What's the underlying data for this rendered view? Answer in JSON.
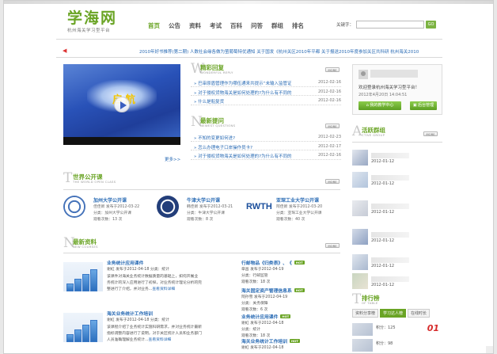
{
  "header": {
    "logo_title": "学海网",
    "logo_subtitle": "杭州海关学习型平台",
    "nav": [
      "首页",
      "公告",
      "资料",
      "考试",
      "百科",
      "问答",
      "群组",
      "排名"
    ],
    "keyword_label": "关键字：",
    "go_label": "GO"
  },
  "ticker": "2010年好书推荐(第二期)  人数社会缘各做为萤葡萄特优通知  关于国发《杭州关区2010年平都  关于报送2010年度参加关区共科研  杭州海关2010",
  "video": {
    "caption": "启航",
    "more": "更多>>"
  },
  "qa": {
    "title": "精彩回复",
    "en": "WONDERFUL REPLY",
    "rows": [
      {
        "q": "巴审原盾管理作为哪伍通来共提示“未输入监管证",
        "d": "2012-02-16"
      },
      {
        "q": "对于侵权货物海关是如何处理的?为什么有不同的",
        "d": "2012-02-16"
      },
      {
        "q": "什么是船复货",
        "d": "2012-02-16"
      }
    ],
    "new_title": "最新提问",
    "new_en": "NEWEST QUESTIONS",
    "new_rows": [
      {
        "q": "不知的变更如何进?",
        "d": "2012-02-23"
      },
      {
        "q": "怎么办理电子口岸操作员卡?",
        "d": "2012-02-17"
      },
      {
        "q": "对于侵权货物海关是如何处理的?为什么有不同的",
        "d": "2012-02-16"
      }
    ],
    "more": "MORE"
  },
  "open_class": {
    "title": "世界公开课",
    "en": "THE WORLD OPEN CLASS",
    "more": "MORE",
    "items": [
      {
        "name": "加州大学公开课",
        "l1": "佳佳新 发布于2012-03-22",
        "l2": "分类：加州大学公开课",
        "l3": "观看次数：13 次"
      },
      {
        "name": "牛津大学公开课",
        "l1": "韩佳新 发布于2012-03-21",
        "l2": "分类：牛津大学公开课",
        "l3": "观看次数：8 次"
      },
      {
        "name": "亚琛工业大学公开课",
        "l1": "阿佳新 发布于2012-03-20",
        "l2": "分类：亚琛工业大学公开课",
        "l3": "观看次数：40 次"
      }
    ],
    "rwth": "RWTH"
  },
  "resources": {
    "title": "最新资料",
    "en": "NEW COURSES",
    "more": "MORE",
    "left": [
      {
        "t": "业务统计应用课件",
        "l1": "谢虹  发布于2012-04-18 分类：统计",
        "l2": "该课件对海关业务统计数据质量的基础上，如何开展业",
        "l3": "务统计的深入应用进行了初探，对业务统计理论分析的完",
        "l4": "整进行了介绍，并对业务...",
        "link": "查看资料详细"
      },
      {
        "t": "海关业务统计工作培训",
        "l1": "谢虹  发布于2012-04-18 分类：统计",
        "l2": "该课程介绍了业务统计实施科研需求，并对业务统计最新",
        "l3": "指标调整内容进行了说明，对于关区统计人员和业务部门",
        "l4": "人员准确理解业务统计...",
        "link": "查看资料详细"
      }
    ],
    "right": [
      {
        "t": "行邮物品《归类表》、《",
        "hot": "HOT",
        "l1": "章昌  发布于2012-04-19",
        "l2": "分类：行邮监管",
        "l3": "观看次数：18 次"
      },
      {
        "t": "海关固定资产管理信息系",
        "hot": "HOT",
        "l1": "阿孙雪  发布于2012-04-19",
        "l2": "分类：关务保障",
        "l3": "观看次数：6 次"
      },
      {
        "t": "业务统计应用课件",
        "hot": "HOT",
        "l1": "谢虹  发布于2012-04-18",
        "l2": "分类：统计",
        "l3": "观看次数：18 次"
      },
      {
        "t": "海关业务统计工作培训",
        "hot": "HOT",
        "l1": "谢虹  发布于2012-04-18",
        "l2": "分类：统计",
        "l3": ""
      }
    ]
  },
  "login": {
    "welcome": "欢迎登录杭州海关学习型平台！",
    "datetime": "2012年4月20日  14:04:51",
    "btn_center": "我的教学中心",
    "btn_admin": "后台管理"
  },
  "groups": {
    "title": "活跃群组",
    "en": "CTIVE GROUP",
    "more": "MORE",
    "dates": [
      "2012-01-12",
      "2012-01-12",
      "2012-01-12",
      "2012-01-12",
      "2012-01-12",
      "2012-01-12",
      "2012-01-12"
    ]
  },
  "ranking": {
    "title": "排行榜",
    "en": "OF TABLE",
    "tabs": [
      "资料分享榜",
      "学习达人榜",
      "在线时长"
    ],
    "rows": [
      {
        "l": "积分：125",
        "n": "01"
      },
      {
        "l": "积分：98",
        "n": ""
      }
    ]
  }
}
